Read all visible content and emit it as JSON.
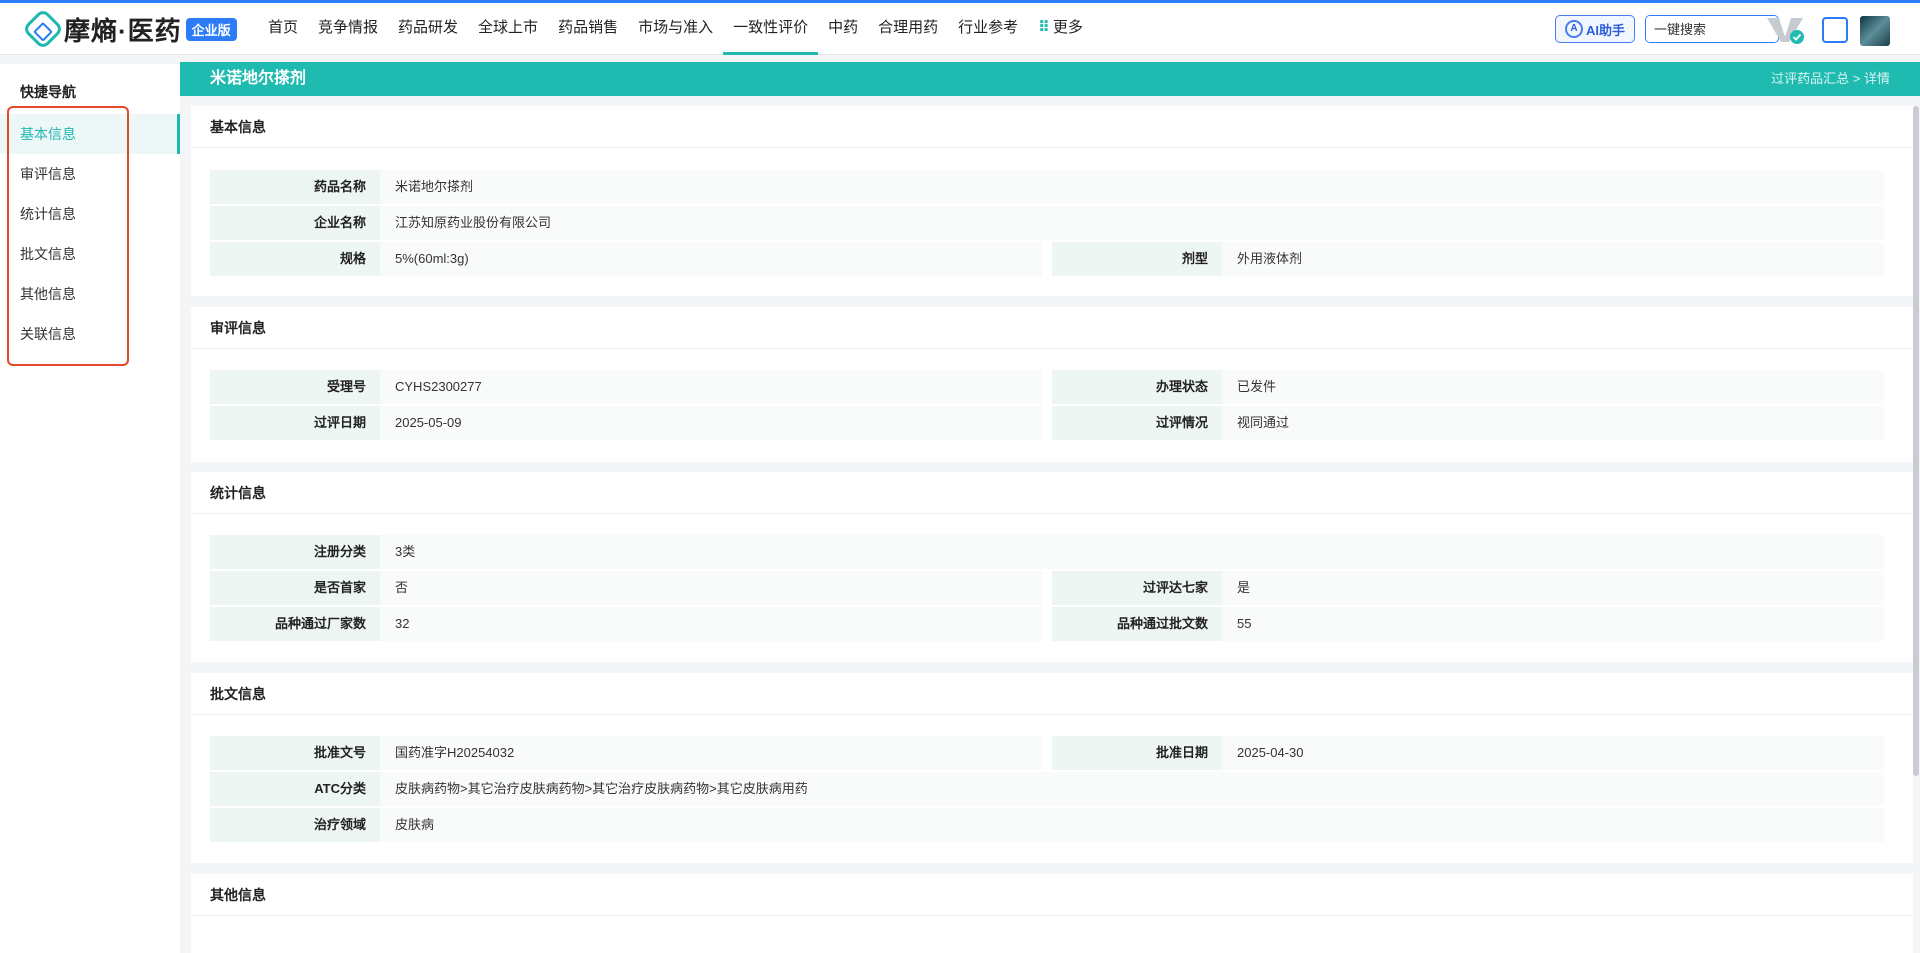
{
  "header": {
    "logo_text": "摩熵·医药",
    "logo_badge": "企业版",
    "nav": [
      "首页",
      "竞争情报",
      "药品研发",
      "全球上市",
      "药品销售",
      "市场与准入",
      "一致性评价",
      "中药",
      "合理用药",
      "行业参考",
      "更多"
    ],
    "active_nav": "一致性评价",
    "ai_label": "AI助手",
    "search_placeholder": "一键搜索"
  },
  "sidebar": {
    "title": "快捷导航",
    "items": [
      "基本信息",
      "审评信息",
      "统计信息",
      "批文信息",
      "其他信息",
      "关联信息"
    ]
  },
  "titlebar": {
    "title": "米诺地尔搽剂",
    "breadcrumb": "过评药品汇总 > 详情"
  },
  "sections": {
    "basic": {
      "title": "基本信息",
      "drug_name_label": "药品名称",
      "drug_name": "米诺地尔搽剂",
      "company_label": "企业名称",
      "company": "江苏知原药业股份有限公司",
      "spec_label": "规格",
      "spec": "5%(60ml:3g)",
      "dosage_label": "剂型",
      "dosage": "外用液体剂"
    },
    "review": {
      "title": "审评信息",
      "accept_no_label": "受理号",
      "accept_no": "CYHS2300277",
      "status_label": "办理状态",
      "status": "已发件",
      "date_label": "过评日期",
      "date": "2025-05-09",
      "result_label": "过评情况",
      "result": "视同通过"
    },
    "stats": {
      "title": "统计信息",
      "reg_class_label": "注册分类",
      "reg_class": "3类",
      "first_label": "是否首家",
      "first": "否",
      "seven_label": "过评达七家",
      "seven": "是",
      "factory_count_label": "品种通过厂家数",
      "factory_count": "32",
      "approval_count_label": "品种通过批文数",
      "approval_count": "55"
    },
    "approval": {
      "title": "批文信息",
      "approval_no_label": "批准文号",
      "approval_no": "国药准字H20254032",
      "approval_date_label": "批准日期",
      "approval_date": "2025-04-30",
      "atc_label": "ATC分类",
      "atc": "皮肤病药物>其它治疗皮肤病药物>其它治疗皮肤病药物>其它皮肤病用药",
      "field_label": "治疗领域",
      "field": "皮肤病"
    },
    "other": {
      "title": "其他信息"
    }
  },
  "colors": {
    "teal": "#1fbbb0",
    "blue": "#2b7cf6",
    "highlight": "#e04a2a"
  }
}
